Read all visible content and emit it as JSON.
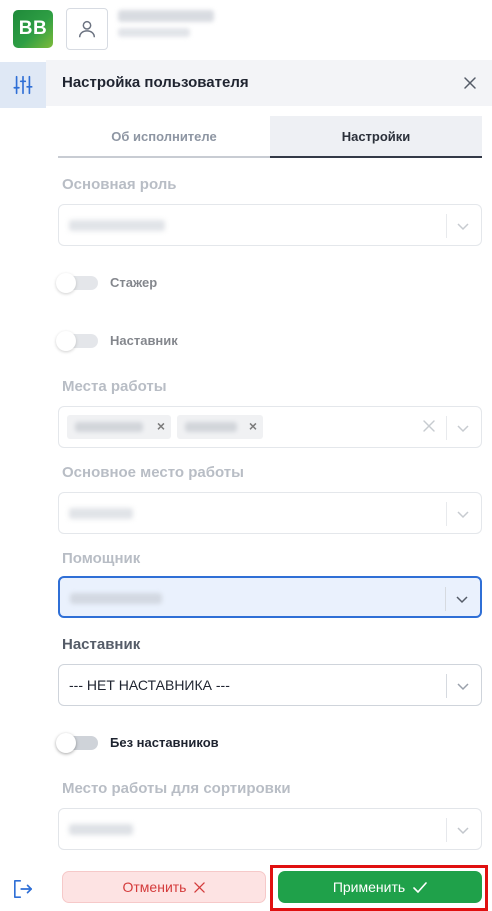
{
  "header": {
    "logo_text": "BB",
    "user_icon": "user-icon"
  },
  "sidebar": {
    "filter_icon": "sliders-icon",
    "logout_icon": "logout-icon"
  },
  "panel": {
    "title": "Настройка пользователя",
    "close_icon": "close-icon",
    "tabs": [
      {
        "label": "Об исполнителе",
        "active": false
      },
      {
        "label": "Настройки",
        "active": true
      }
    ],
    "fields": {
      "main_role": {
        "label": "Основная роль"
      },
      "trainee": {
        "label": "Стажер",
        "on": false
      },
      "mentor_toggle": {
        "label": "Наставник",
        "on": false
      },
      "workplaces": {
        "label": "Места работы"
      },
      "main_workplace": {
        "label": "Основное место работы"
      },
      "assistant": {
        "label": "Помощник"
      },
      "mentor": {
        "label": "Наставник",
        "value": "--- НЕТ НАСТАВНИКА ---"
      },
      "no_mentors": {
        "label": "Без наставников",
        "on": false
      },
      "sort_workplace": {
        "label": "Место работы для сортировки"
      }
    }
  },
  "footer": {
    "cancel_label": "Отменить",
    "apply_label": "Применить"
  },
  "colors": {
    "accent_green": "#1fa14a",
    "cancel_red": "#d43b3b",
    "focus_blue": "#2f6fd6",
    "highlight_red": "#e01010"
  }
}
